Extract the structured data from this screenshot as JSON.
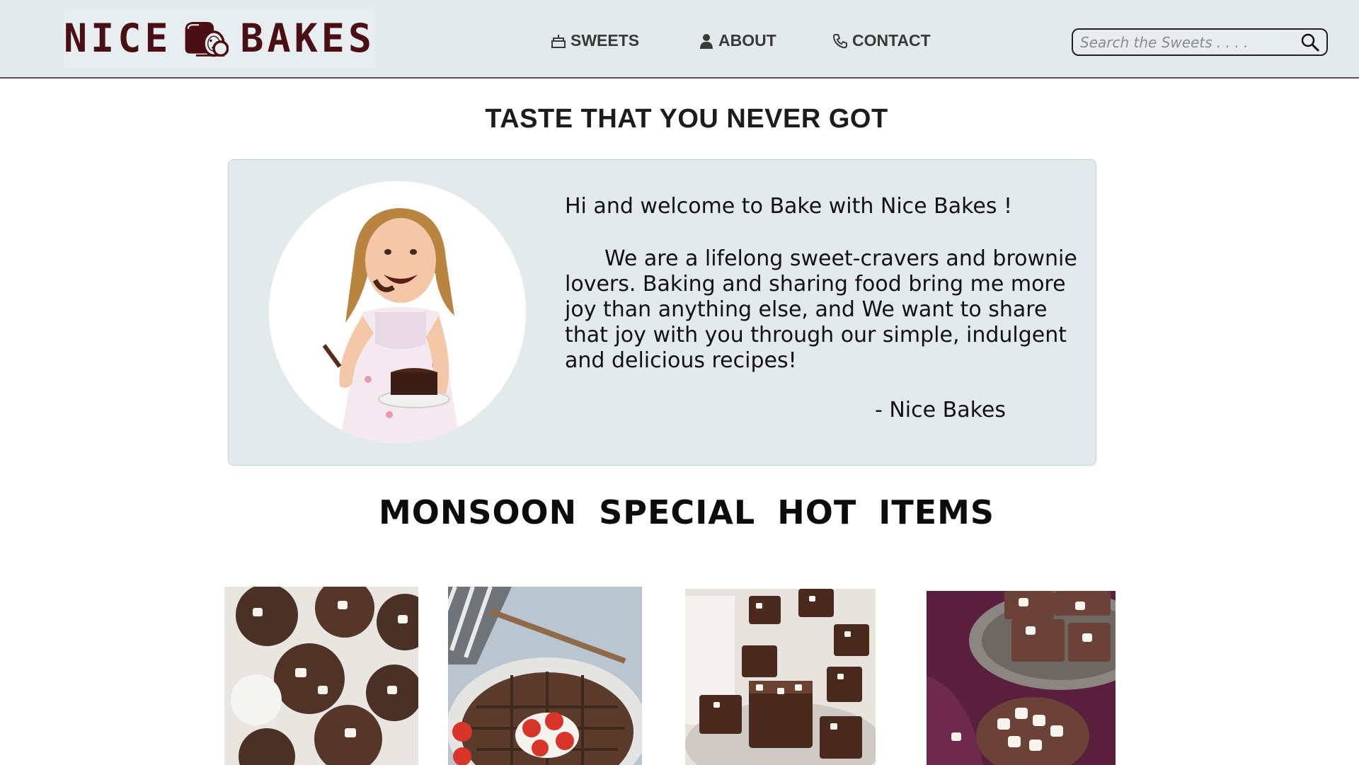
{
  "header": {
    "logo": {
      "word_left": "NICE",
      "word_right": "BAKES",
      "icon": "bread-loaf-icon",
      "color": "#4a0f14"
    },
    "nav": [
      {
        "label": "SWEETS",
        "icon": "cake-icon"
      },
      {
        "label": "ABOUT",
        "icon": "user-icon"
      },
      {
        "label": "CONTACT",
        "icon": "phone-icon"
      }
    ],
    "search": {
      "placeholder": "Search the Sweets . . . .",
      "value": "",
      "icon": "search-icon"
    }
  },
  "tagline": "TASTE THAT YOU NEVER GOT",
  "welcome": {
    "greeting": "Hi and welcome to Bake with Nice Bakes !",
    "body": "We are a lifelong sweet-cravers and brownie lovers. Baking and sharing food bring me more joy than anything else, and We want to share that joy with you through our simple, indulgent and delicious recipes!",
    "signature": "- Nice Bakes",
    "photo": "girl-eating-cake-photo"
  },
  "section_title": "MONSOON SPECIAL HOT ITEMS",
  "products": [
    {
      "photo": "marshmallow-cookies-photo"
    },
    {
      "photo": "chocolate-waffle-strawberries-photo"
    },
    {
      "photo": "marshmallow-brownies-photo"
    },
    {
      "photo": "marshmallow-fudge-photo"
    }
  ],
  "colors": {
    "header_bg": "#e3eaeb",
    "card_bg": "#e3eaeb",
    "brand": "#4a0f14",
    "text": "#111111"
  }
}
